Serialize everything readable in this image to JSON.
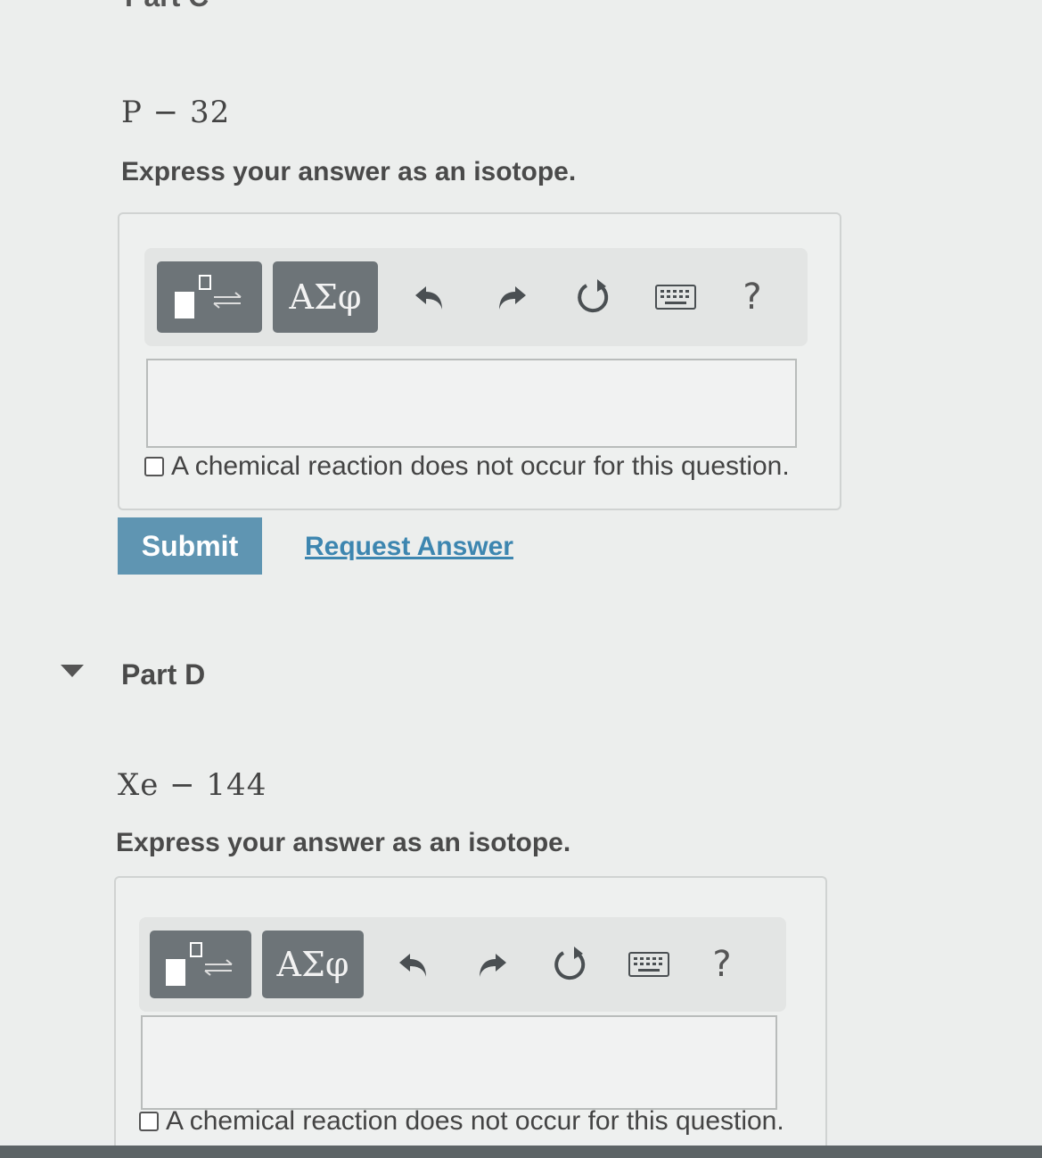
{
  "part_c": {
    "header": "Part C",
    "isotope": "P − 32",
    "instruction": "Express your answer as an isotope.",
    "toolbar": {
      "template_icon": "isotope-template-icon",
      "greek_label": "ΑΣφ",
      "undo_icon": "undo-icon",
      "redo_icon": "redo-icon",
      "reset_icon": "reset-icon",
      "keyboard_icon": "keyboard-icon",
      "help_label": "?"
    },
    "answer_value": "",
    "no_reaction_label": "A chemical reaction does not occur for this question.",
    "submit_label": "Submit",
    "request_label": "Request Answer"
  },
  "part_d": {
    "title": "Part D",
    "isotope": "Xe − 144",
    "instruction": "Express your answer as an isotope.",
    "toolbar": {
      "template_icon": "isotope-template-icon",
      "greek_label": "ΑΣφ",
      "undo_icon": "undo-icon",
      "redo_icon": "redo-icon",
      "reset_icon": "reset-icon",
      "keyboard_icon": "keyboard-icon",
      "help_label": "?"
    },
    "answer_value": "",
    "no_reaction_label": "A chemical reaction does not occur for this question."
  }
}
